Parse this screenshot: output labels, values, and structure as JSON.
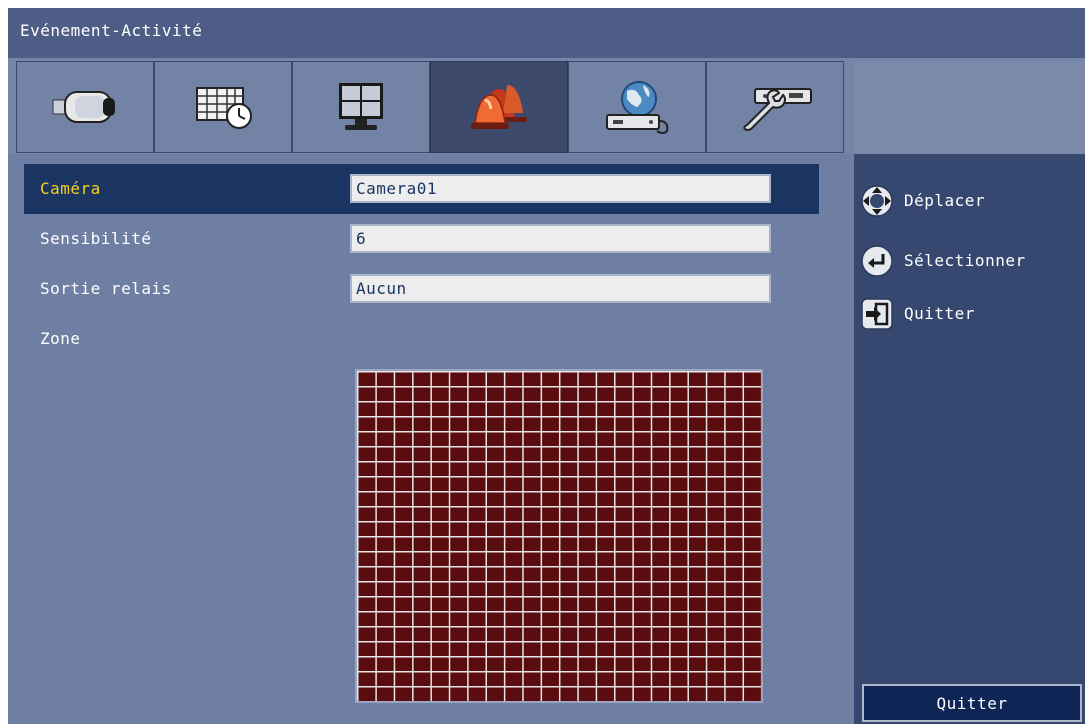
{
  "window": {
    "title": "Evénement-Activité"
  },
  "tabs": [
    {
      "icon": "camera-icon",
      "active": false
    },
    {
      "icon": "schedule-icon",
      "active": false
    },
    {
      "icon": "monitor-icon",
      "active": false
    },
    {
      "icon": "alarm-icon",
      "active": true
    },
    {
      "icon": "network-icon",
      "active": false
    },
    {
      "icon": "system-tools-icon",
      "active": false
    }
  ],
  "settings": {
    "camera": {
      "label": "Caméra",
      "value": "Camera01"
    },
    "sensitivity": {
      "label": "Sensibilité",
      "value": "6"
    },
    "relay_output": {
      "label": "Sortie relais",
      "value": "Aucun"
    },
    "zone": {
      "label": "Zone"
    }
  },
  "zone_grid": {
    "columns": 22,
    "rows": 22
  },
  "help": {
    "move_label": "Déplacer",
    "select_label": "Sélectionner",
    "quit_label": "Quitter"
  },
  "quit_button": {
    "label": "Quitter"
  },
  "colors": {
    "background": "#5e7196",
    "title_bar": "#4e5d85",
    "selected_row": "#1b3562",
    "selected_label": "#f3d11f",
    "sidebar": "#36486f",
    "zone_cell": "#5a0c0e"
  }
}
